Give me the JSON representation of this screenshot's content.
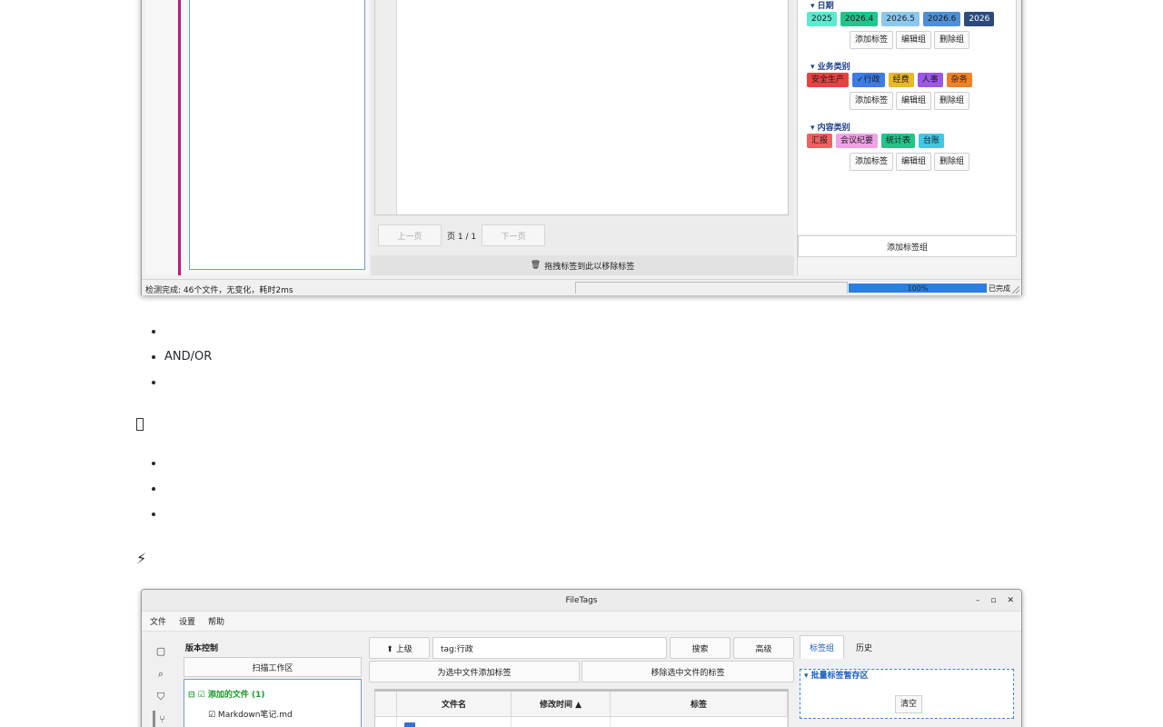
{
  "top_screenshot": {
    "pager": {
      "prev": "上一页",
      "page_info": "页 1 / 1",
      "next": "下一页"
    },
    "drop_zone": {
      "icon": "trash-icon",
      "text": "拖拽标签到此以移除标签"
    },
    "tag_groups": [
      {
        "title": "▾ 日期",
        "tags": [
          {
            "label": "2025",
            "bg": "#5ee8cf"
          },
          {
            "label": "2026.4",
            "bg": "#1fc58c"
          },
          {
            "label": "2026.5",
            "bg": "#8cc8ee"
          },
          {
            "label": "2026.6",
            "bg": "#4f8fd8"
          },
          {
            "label": "2026",
            "bg": "#2d4a7c",
            "fg": "#ffffff"
          }
        ]
      },
      {
        "title": "▾ 业务类别",
        "tags": [
          {
            "label": "安全生产",
            "bg": "#e94141"
          },
          {
            "label": "✓行政",
            "bg": "#3e7be8"
          },
          {
            "label": "经费",
            "bg": "#e8b926"
          },
          {
            "label": "人事",
            "bg": "#9b57e6"
          },
          {
            "label": "杂务",
            "bg": "#f08124"
          }
        ]
      },
      {
        "title": "▾ 内容类别",
        "tags": [
          {
            "label": "汇报",
            "bg": "#f06262"
          },
          {
            "label": "会议纪要",
            "bg": "#f1a1e6"
          },
          {
            "label": "统计表",
            "bg": "#22c58a"
          },
          {
            "label": "台账",
            "bg": "#40c9e6"
          }
        ]
      }
    ],
    "group_actions": {
      "add_tag": "添加标签",
      "edit_group": "编辑组",
      "delete_group": "删除组"
    },
    "add_group": "添加标签组",
    "status": {
      "text": "检测完成: 46个文件，无变化，耗时2ms",
      "progress": 1.0,
      "progress_label": "100%",
      "done_label": "已完成"
    }
  },
  "md": {
    "list1": [
      "",
      "AND/OR ",
      ""
    ],
    "heading1": {
      "icon": "missing-glyph-icon",
      "text": ""
    },
    "list2": [
      "",
      "",
      ""
    ],
    "heading2": {
      "icon": "lightning-icon",
      "glyph": "⚡",
      "text": ""
    }
  },
  "bottom_screenshot": {
    "title": "FileTags",
    "controls": [
      "–",
      "▫",
      "✕"
    ],
    "menu": [
      "文件",
      "设置",
      "帮助"
    ],
    "left": {
      "section_title": "版本控制",
      "scan_button": "扫描工作区",
      "tree": [
        {
          "text": "⊟ ☑ 添加的文件 (1)"
        },
        {
          "text": "☑ Markdown笔记.md"
        }
      ]
    },
    "toolbar": {
      "up_button": "⬆ 上级",
      "search_value": "tag:行政",
      "search_button": "搜索",
      "advanced_button": "高级",
      "add_tags_button": "为选中文件添加标签",
      "remove_tags_button": "移除选中文件的标签"
    },
    "table_headers": [
      "",
      "文件名",
      "修改时间 ▲",
      "标签"
    ],
    "right": {
      "tabs": [
        "标签组",
        "历史"
      ],
      "batch_title": "▾ 批量标签暂存区",
      "clear_button": "清空"
    }
  }
}
